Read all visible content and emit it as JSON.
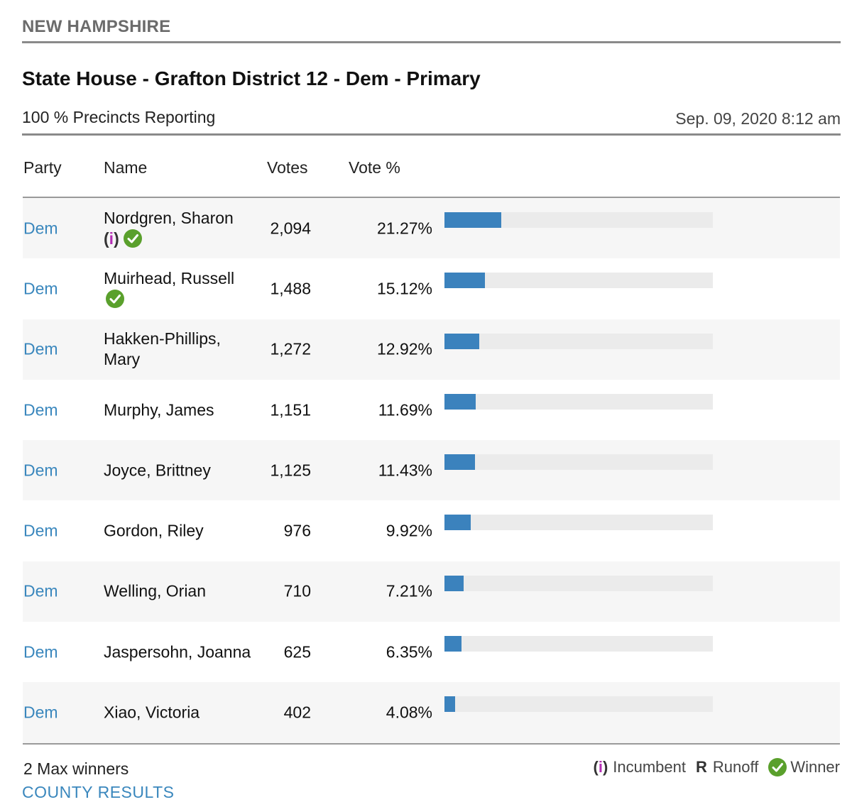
{
  "header": {
    "state": "NEW HAMPSHIRE",
    "race_title": "State House - Grafton District 12 - Dem - Primary",
    "reporting": "100 % Precincts Reporting",
    "updated": "Sep. 09, 2020 8:12 am"
  },
  "table": {
    "columns": {
      "party": "Party",
      "name": "Name",
      "votes": "Votes",
      "vote_pct": "Vote %"
    },
    "rows": [
      {
        "party": "Dem",
        "name": "Nordgren, Sharon",
        "votes": "2,094",
        "pct": "21.27%",
        "share": 0.2127,
        "incumbent": true,
        "winner": true
      },
      {
        "party": "Dem",
        "name": "Muirhead, Russell",
        "votes": "1,488",
        "pct": "15.12%",
        "share": 0.1512,
        "incumbent": false,
        "winner": true
      },
      {
        "party": "Dem",
        "name": "Hakken-Phillips, Mary",
        "votes": "1,272",
        "pct": "12.92%",
        "share": 0.1292,
        "incumbent": false,
        "winner": false
      },
      {
        "party": "Dem",
        "name": "Murphy, James",
        "votes": "1,151",
        "pct": "11.69%",
        "share": 0.1169,
        "incumbent": false,
        "winner": false
      },
      {
        "party": "Dem",
        "name": "Joyce, Brittney",
        "votes": "1,125",
        "pct": "11.43%",
        "share": 0.1143,
        "incumbent": false,
        "winner": false
      },
      {
        "party": "Dem",
        "name": "Gordon, Riley",
        "votes": "976",
        "pct": "9.92%",
        "share": 0.0992,
        "incumbent": false,
        "winner": false
      },
      {
        "party": "Dem",
        "name": "Welling, Orian",
        "votes": "710",
        "pct": "7.21%",
        "share": 0.0721,
        "incumbent": false,
        "winner": false
      },
      {
        "party": "Dem",
        "name": "Jaspersohn, Joanna",
        "votes": "625",
        "pct": "6.35%",
        "share": 0.0635,
        "incumbent": false,
        "winner": false
      },
      {
        "party": "Dem",
        "name": "Xiao, Victoria",
        "votes": "402",
        "pct": "4.08%",
        "share": 0.0408,
        "incumbent": false,
        "winner": false
      }
    ]
  },
  "footer": {
    "max_winners": "2 Max winners",
    "county_link": "COUNTY RESULTS",
    "legend": {
      "incumbent_open": "(",
      "incumbent_mark": "i",
      "incumbent_close": ")",
      "incumbent_label": "Incumbent",
      "runoff_mark": "R",
      "runoff_label": "Runoff",
      "winner_label": "Winner"
    }
  },
  "icons": {
    "winner": "check-circle-icon",
    "incumbent": "incumbent-i-marker"
  },
  "colors": {
    "bar": "#3b82bd",
    "track": "#ebebeb",
    "link": "#3a87bd",
    "winner": "#5aa02c",
    "incumbent": "#b42fb4"
  }
}
